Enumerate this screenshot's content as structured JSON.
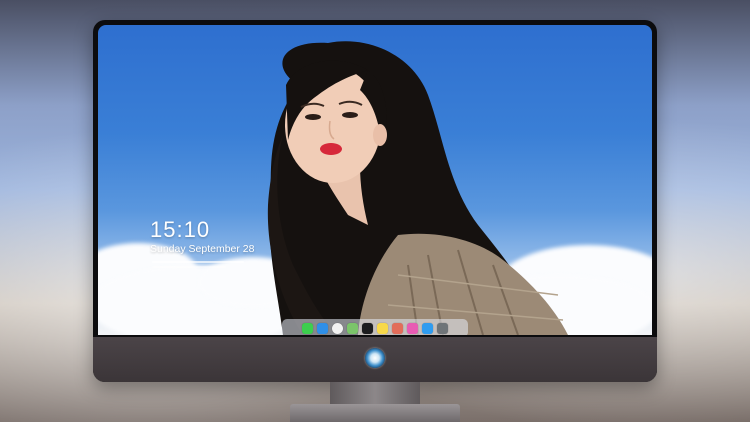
{
  "lock_screen": {
    "time": "15:10",
    "date": "Sunday September 28"
  },
  "dock": {
    "apps": [
      {
        "name": "messages-icon",
        "color": "#3ccf4e"
      },
      {
        "name": "finder-icon",
        "color": "#2f8fe8"
      },
      {
        "name": "safari-icon",
        "color": "#f2f2f2"
      },
      {
        "name": "maps-icon",
        "color": "#7bc46a"
      },
      {
        "name": "clapperboard-icon",
        "color": "#1c1c1e"
      },
      {
        "name": "notes-icon",
        "color": "#f7d84a"
      },
      {
        "name": "photos-icon",
        "color": "#e26d5a"
      },
      {
        "name": "itunes-icon",
        "color": "#e85bb3"
      },
      {
        "name": "app-store-icon",
        "color": "#2f9cf0"
      },
      {
        "name": "camera-icon",
        "color": "#6f7478"
      }
    ]
  },
  "monitor": {
    "logo_icon": "round-emblem-logo-icon"
  }
}
